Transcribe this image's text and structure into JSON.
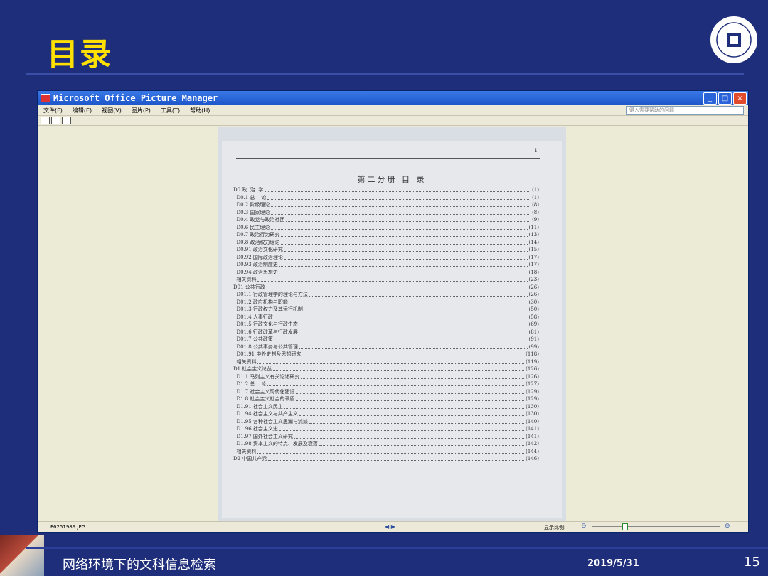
{
  "slide": {
    "title": "目录",
    "footer_title": "网络环境下的文科信息检索",
    "date": "2019/5/31",
    "page_number": "15"
  },
  "window": {
    "title": "Microsoft Office Picture Manager",
    "menu": [
      "文件(F)",
      "编辑(E)",
      "视图(V)",
      "图片(P)",
      "工具(T)",
      "帮助(H)"
    ],
    "help_placeholder": "键入需要帮助的问题",
    "controls": {
      "minimize": "_",
      "maximize": "□",
      "close": "×"
    }
  },
  "document": {
    "page_number": "1",
    "heading": "第二分册     目     录",
    "entries": [
      {
        "label": "D0 政  治  学",
        "page": "(1)"
      },
      {
        "label": "  D0.1 总    论",
        "page": "(1)"
      },
      {
        "label": "  D0.2 阶级理论",
        "page": "(8)"
      },
      {
        "label": "  D0.3 国家理论",
        "page": "(8)"
      },
      {
        "label": "  D0.4 政党与政治社团",
        "page": "(9)"
      },
      {
        "label": "  D0.6 民主理论",
        "page": "(11)"
      },
      {
        "label": "  D0.7 政治行为研究",
        "page": "(13)"
      },
      {
        "label": "  D0.8 政治权力理论",
        "page": "(14)"
      },
      {
        "label": "  D0.91 政治文化研究",
        "page": "(15)"
      },
      {
        "label": "  D0.92 国际政治理论",
        "page": "(17)"
      },
      {
        "label": "  D0.93 政治制度史",
        "page": "(17)"
      },
      {
        "label": "  D0.94 政治思想史",
        "page": "(18)"
      },
      {
        "label": "  相关资料",
        "page": "(23)"
      },
      {
        "label": "D01 公共行政",
        "page": "(26)"
      },
      {
        "label": "  D01.1 行政管理学的理论与方法",
        "page": "(26)"
      },
      {
        "label": "  D01.2 政府机构与职能",
        "page": "(30)"
      },
      {
        "label": "  D01.3 行政权力及其运行机制",
        "page": "(50)"
      },
      {
        "label": "  D01.4 人事行政",
        "page": "(58)"
      },
      {
        "label": "  D01.5 行政文化与行政生态",
        "page": "(69)"
      },
      {
        "label": "  D01.6 行政改革与行政发展",
        "page": "(81)"
      },
      {
        "label": "  D01.7 公共政策",
        "page": "(91)"
      },
      {
        "label": "  D01.8 公共事务与公共管理",
        "page": "(99)"
      },
      {
        "label": "  D01.91 中外史制及思想研究",
        "page": "(118)"
      },
      {
        "label": "  相关资料",
        "page": "(119)"
      },
      {
        "label": "D1 社会主义论丛",
        "page": "(126)"
      },
      {
        "label": "  D1.1 马列主义有关论述研究",
        "page": "(126)"
      },
      {
        "label": "  D1.2 总    论",
        "page": "(127)"
      },
      {
        "label": "  D1.7 社会主义现代化建设",
        "page": "(129)"
      },
      {
        "label": "  D1.8 社会主义社会的矛盾",
        "page": "(129)"
      },
      {
        "label": "  D1.91 社会主义民主",
        "page": "(130)"
      },
      {
        "label": "  D1.94 社会主义与共产主义",
        "page": "(130)"
      },
      {
        "label": "  D1.95 各种社会主义思潮与流派",
        "page": "(140)"
      },
      {
        "label": "  D1.96 社会主义史",
        "page": "(141)"
      },
      {
        "label": "  D1.97 国外社会主义研究",
        "page": "(141)"
      },
      {
        "label": "  D1.98 资本主义的特点、发展及衰落",
        "page": "(142)"
      },
      {
        "label": "  相关资料",
        "page": "(144)"
      },
      {
        "label": "D2 中国共产党",
        "page": "(146)"
      }
    ]
  },
  "status": {
    "filename": "F6251989.JPG",
    "nav": "◀  ▶",
    "zoom_label": "显示比例:"
  },
  "colors": {
    "background": "#1f2e7a",
    "title": "#ffe000"
  }
}
